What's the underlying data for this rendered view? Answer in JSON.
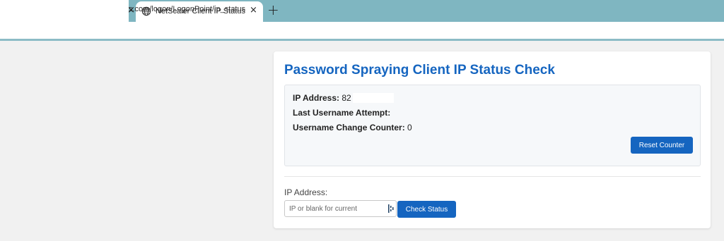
{
  "browser": {
    "prev_tab_close": "×",
    "active_tab": {
      "title": "NetScaler Client IP Status",
      "close": "×",
      "icon": "globe-icon"
    },
    "new_tab": "+",
    "url": "s.com/logon/LogonPoint/ip_status"
  },
  "page": {
    "title": "Password Spraying Client IP Status Check",
    "status": {
      "ip_label": "IP Address:",
      "ip_value": "82",
      "last_username_label": "Last Username Attempt:",
      "last_username_value": "",
      "counter_label": "Username Change Counter:",
      "counter_value": "0",
      "reset_button": "Reset Counter"
    },
    "form": {
      "ip_label": "IP Address:",
      "ip_placeholder": "IP or blank for current",
      "ip_value": "",
      "check_button": "Check Status"
    }
  },
  "colors": {
    "tabstrip": "#7fb6c1",
    "accent": "#1565c0",
    "page_bg": "#f1f1f1"
  }
}
